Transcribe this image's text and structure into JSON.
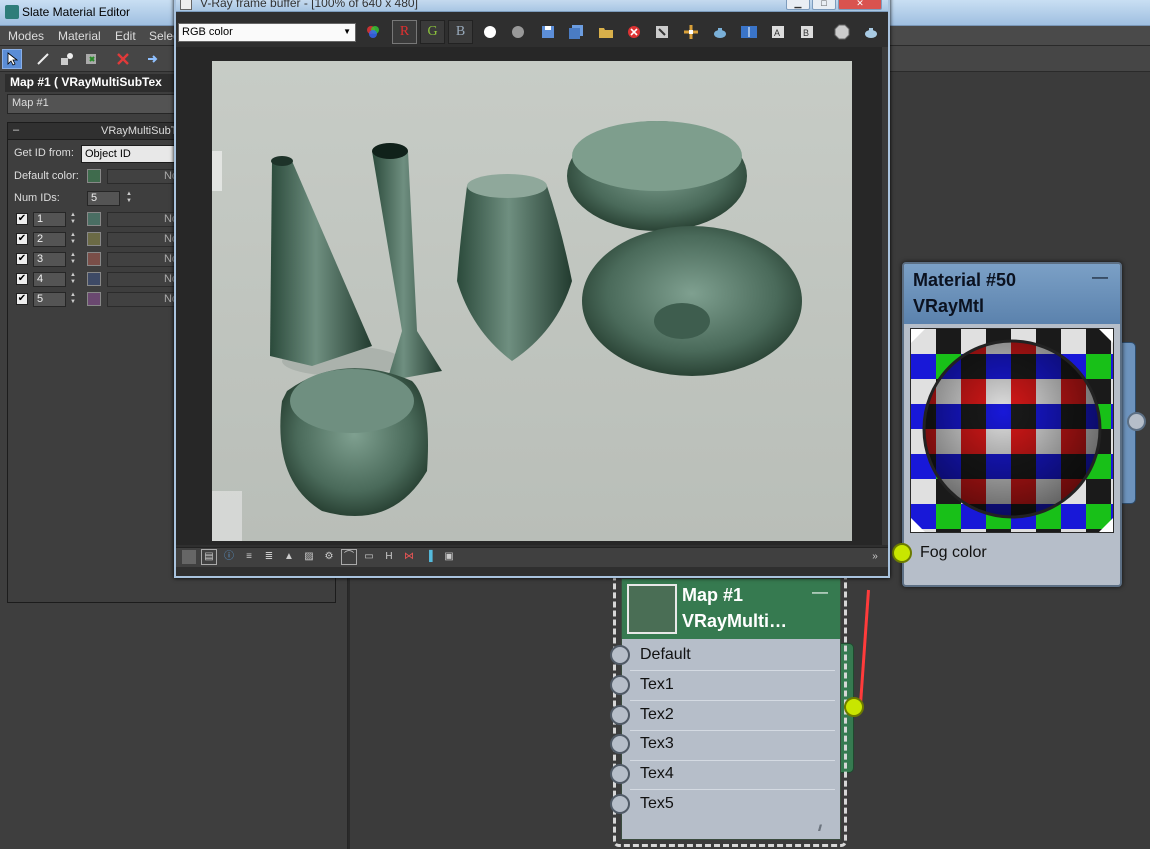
{
  "app": {
    "title": "Slate Material Editor"
  },
  "menu": [
    "Modes",
    "Material",
    "Edit",
    "Selec"
  ],
  "params": {
    "header": "Map #1  ( VRayMultiSubTex",
    "map_name": "Map #1",
    "rollout_title": "VRayMultiSubTe",
    "get_id_label": "Get ID from:",
    "get_id_value": "Object ID",
    "default_color_label": "Default color:",
    "none_label": "No",
    "num_ids_label": "Num IDs:",
    "num_ids_value": "5",
    "rows": [
      {
        "id": "1",
        "color": "#4a6e63"
      },
      {
        "id": "2",
        "color": "#6b6a45"
      },
      {
        "id": "3",
        "color": "#7a4e48"
      },
      {
        "id": "4",
        "color": "#3e4a66"
      },
      {
        "id": "5",
        "color": "#6a4870"
      }
    ],
    "default_color": "#3f6b4d"
  },
  "vfb": {
    "title": "V-Ray frame buffer - [100% of 640 x 480]",
    "channel": "RGB color",
    "red_label": "R",
    "green_label": "G",
    "blue_label": "B",
    "bottom_h_label": "H"
  },
  "material_node": {
    "name": "Material #50",
    "type": "VRayMtl",
    "minimize": "—",
    "slot": "Fog color"
  },
  "map_node": {
    "name": "Map #1",
    "type": "VRayMulti…",
    "minimize": "—",
    "slots": [
      "Default",
      "Tex1",
      "Tex2",
      "Tex3",
      "Tex4",
      "Tex5"
    ]
  },
  "colors": {
    "accent_green": "#367a50",
    "accent_blue": "#5b82ad",
    "port_active": "#c8e600",
    "wire": "#ff3b3b"
  }
}
